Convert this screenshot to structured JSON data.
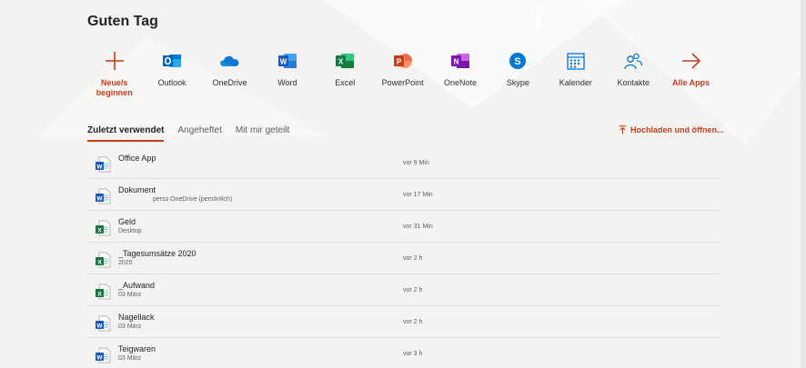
{
  "greeting": "Guten Tag",
  "apps": [
    {
      "label": "Neue/s\nbeginnen",
      "icon": "plus-icon",
      "accent": true
    },
    {
      "label": "Outlook",
      "icon": "outlook-icon"
    },
    {
      "label": "OneDrive",
      "icon": "onedrive-icon"
    },
    {
      "label": "Word",
      "icon": "word-icon"
    },
    {
      "label": "Excel",
      "icon": "excel-icon"
    },
    {
      "label": "PowerPoint",
      "icon": "powerpoint-icon"
    },
    {
      "label": "OneNote",
      "icon": "onenote-icon"
    },
    {
      "label": "Skype",
      "icon": "skype-icon"
    },
    {
      "label": "Kalender",
      "icon": "calendar-icon"
    },
    {
      "label": "Kontakte",
      "icon": "contacts-icon"
    },
    {
      "label": "Alle Apps",
      "icon": "arrow-right-icon",
      "accent": true
    }
  ],
  "tabs": [
    {
      "label": "Zuletzt verwendet",
      "active": true
    },
    {
      "label": "Angeheftet"
    },
    {
      "label": "Mit mir geteilt"
    }
  ],
  "upload_label": "Hochladen und öffnen...",
  "files": [
    {
      "type": "word",
      "name": "Office App",
      "location": "",
      "time": "vor 9 Min"
    },
    {
      "type": "word",
      "name": "Dokument",
      "location": "perss OneDrive (persönlich)",
      "time": "vor 17 Min"
    },
    {
      "type": "excel",
      "name": "Geld",
      "location": "Desktop",
      "time": "vor 31 Min"
    },
    {
      "type": "excel",
      "name": "_Tagesumsätze 2020",
      "location": "2020",
      "time": "vor 2 h"
    },
    {
      "type": "excel",
      "name": "_Aufwand",
      "location": "03 März",
      "time": "vor 2 h"
    },
    {
      "type": "word",
      "name": "Nagellack",
      "location": "03 März",
      "time": "vor 2 h"
    },
    {
      "type": "word",
      "name": "Teigwaren",
      "location": "03 März",
      "time": "vor 3 h"
    }
  ],
  "colors": {
    "accent": "#c43e1c",
    "word": "#185abd",
    "excel": "#107c41"
  }
}
